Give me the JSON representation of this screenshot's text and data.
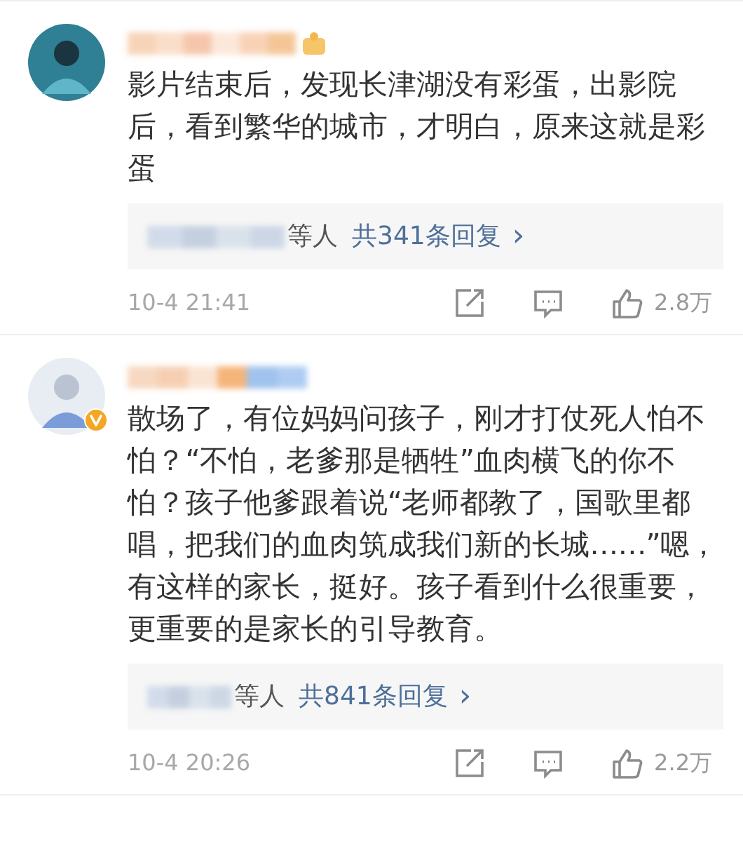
{
  "comments": [
    {
      "verified": false,
      "text": "影片结束后，发现长津湖没有彩蛋，出影院后，看到繁华的城市，才明白，原来这就是彩蛋",
      "replies": {
        "suffix": "等人",
        "link": "共341条回复",
        "chevron": "›"
      },
      "time": "10-4 21:41",
      "likes": "2.8万"
    },
    {
      "verified": true,
      "text": "散场了，有位妈妈问孩子，刚才打仗死人怕不怕？“不怕，老爹那是牺牲”血肉横飞的你不怕？孩子他爹跟着说“老师都教了，国歌里都唱，把我们的血肉筑成我们新的长城……”嗯，有这样的家长，挺好。孩子看到什么很重要，更重要的是家长的引导教育。",
      "replies": {
        "suffix": "等人",
        "link": "共841条回复",
        "chevron": "›"
      },
      "time": "10-4 20:26",
      "likes": "2.2万"
    }
  ]
}
